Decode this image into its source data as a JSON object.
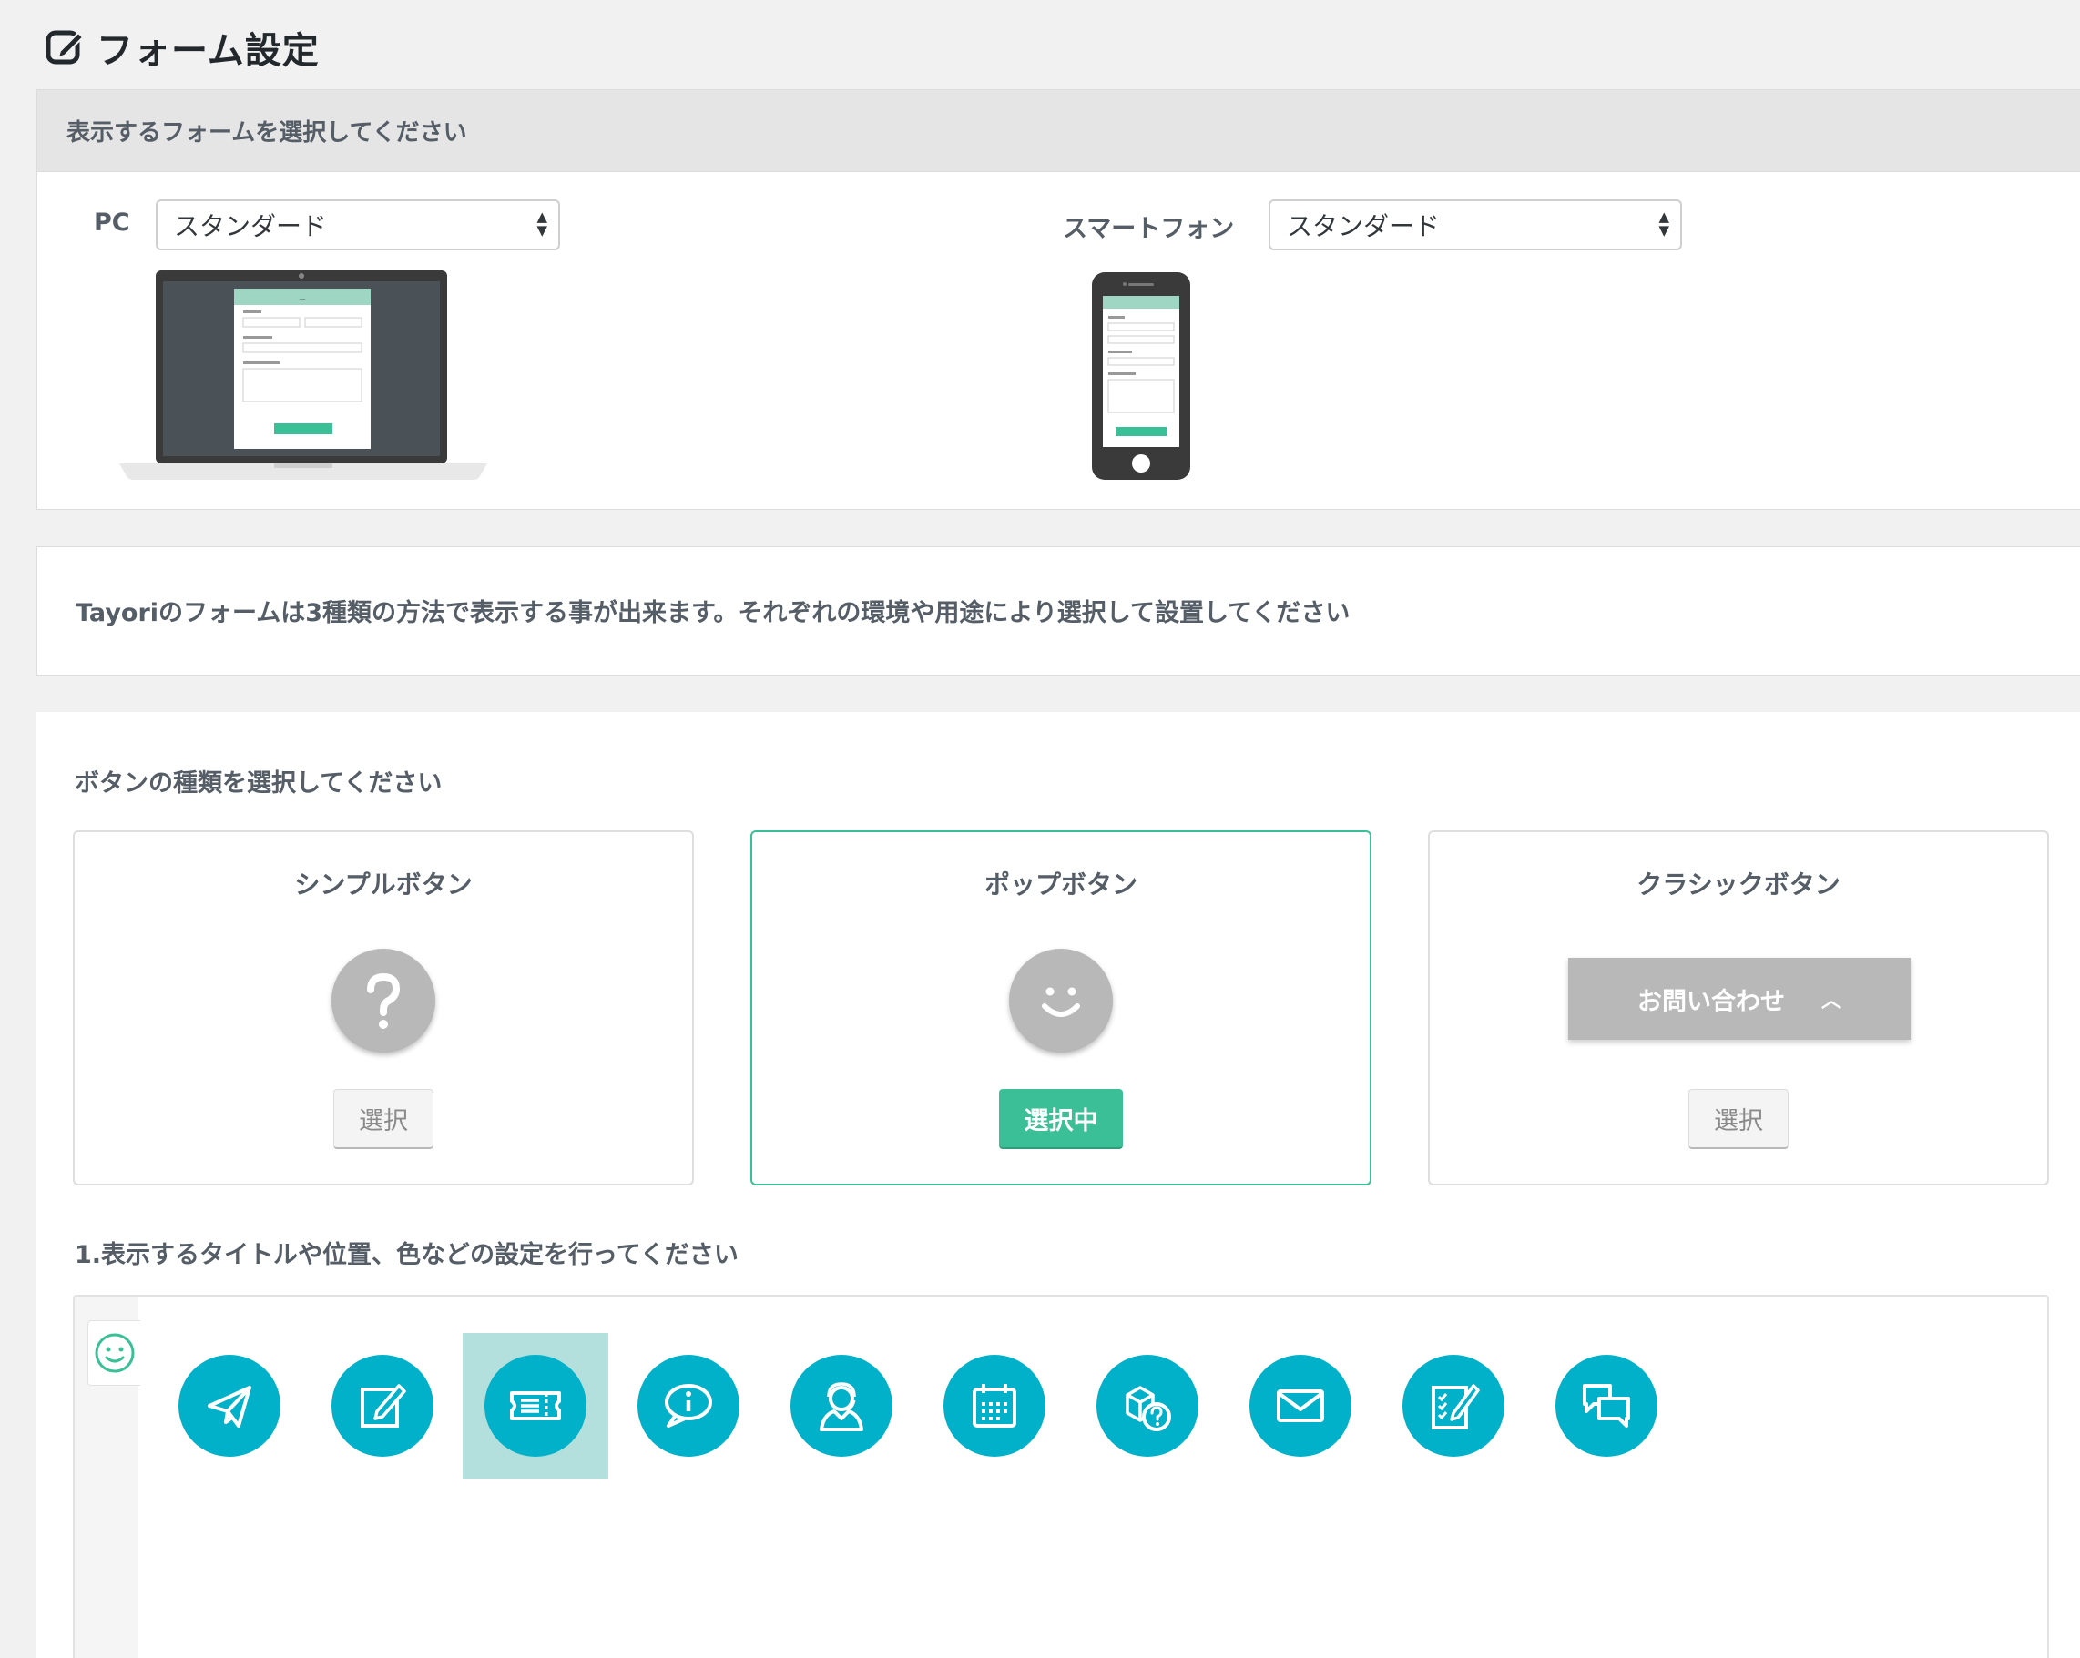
{
  "page": {
    "title": "フォーム設定",
    "title_icon": "edit-square-icon"
  },
  "form_select": {
    "heading": "表示するフォームを選択してください",
    "pc": {
      "label": "PC",
      "value": "スタンダード"
    },
    "smartphone": {
      "label": "スマートフォン",
      "value": "スタンダード"
    }
  },
  "info": {
    "text": "Tayoriのフォームは3種類の方法で表示する事が出来ます。それぞれの環境や用途により選択して設置してください"
  },
  "button_type": {
    "heading": "ボタンの種類を選択してください",
    "cards": [
      {
        "title": "シンプルボタン",
        "icon": "question-mark-icon",
        "action": "選択",
        "selected": false
      },
      {
        "title": "ポップボタン",
        "icon": "smiley-icon",
        "action": "選択中",
        "selected": true
      },
      {
        "title": "クラシックボタン",
        "preview_label": "お問い合わせ",
        "action": "選択",
        "selected": false
      }
    ]
  },
  "settings": {
    "heading": "1.表示するタイトルや位置、色などの設定を行ってください",
    "icon_color": "#00b1c9",
    "accent_color": "#3bbf97",
    "icons": [
      "paper-plane-icon",
      "edit-note-icon",
      "ticket-icon",
      "info-bubble-icon",
      "operator-icon",
      "calendar-icon",
      "package-question-icon",
      "envelope-icon",
      "checklist-icon",
      "chat-bubbles-icon"
    ],
    "selected_icon": "ticket-icon"
  }
}
